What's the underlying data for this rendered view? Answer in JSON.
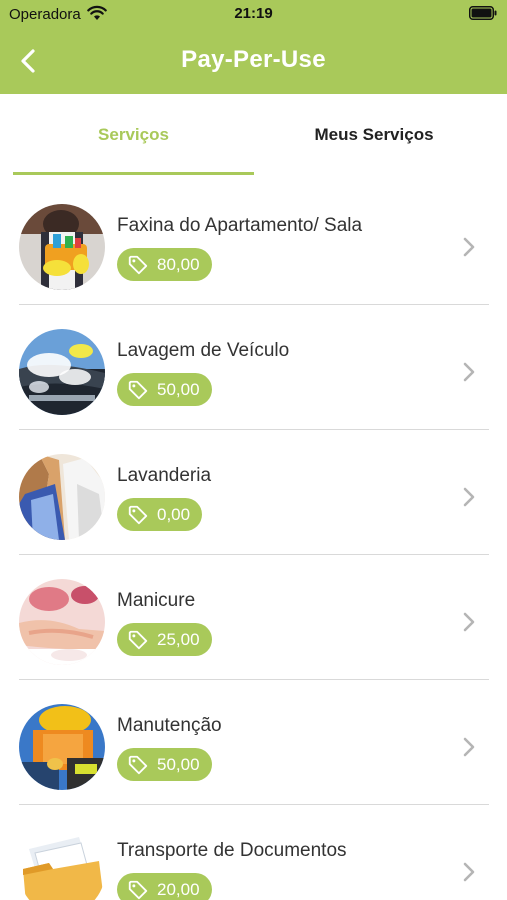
{
  "status_bar": {
    "carrier": "Operadora",
    "time": "21:19"
  },
  "nav": {
    "title": "Pay-Per-Use"
  },
  "tabs": [
    {
      "label": "Serviços",
      "active": true
    },
    {
      "label": "Meus Serviços",
      "active": false
    }
  ],
  "services": [
    {
      "name": "Faxina do Apartamento/ Sala",
      "price": "80,00",
      "image": "cleaning-photo"
    },
    {
      "name": "Lavagem de Veículo",
      "price": "50,00",
      "image": "car-wash-photo"
    },
    {
      "name": "Lavanderia",
      "price": "0,00",
      "image": "laundry-photo"
    },
    {
      "name": "Manicure",
      "price": "25,00",
      "image": "manicure-photo"
    },
    {
      "name": "Manutenção",
      "price": "50,00",
      "image": "maintenance-photo"
    },
    {
      "name": "Transporte de Documentos",
      "price": "20,00",
      "image": "documents-photo"
    }
  ],
  "colors": {
    "accent": "#a9c95a",
    "text": "#333333",
    "separator": "#d9d9d9"
  },
  "icons": {
    "back": "chevron-left-icon",
    "price": "tag-icon",
    "row": "chevron-right-icon"
  }
}
